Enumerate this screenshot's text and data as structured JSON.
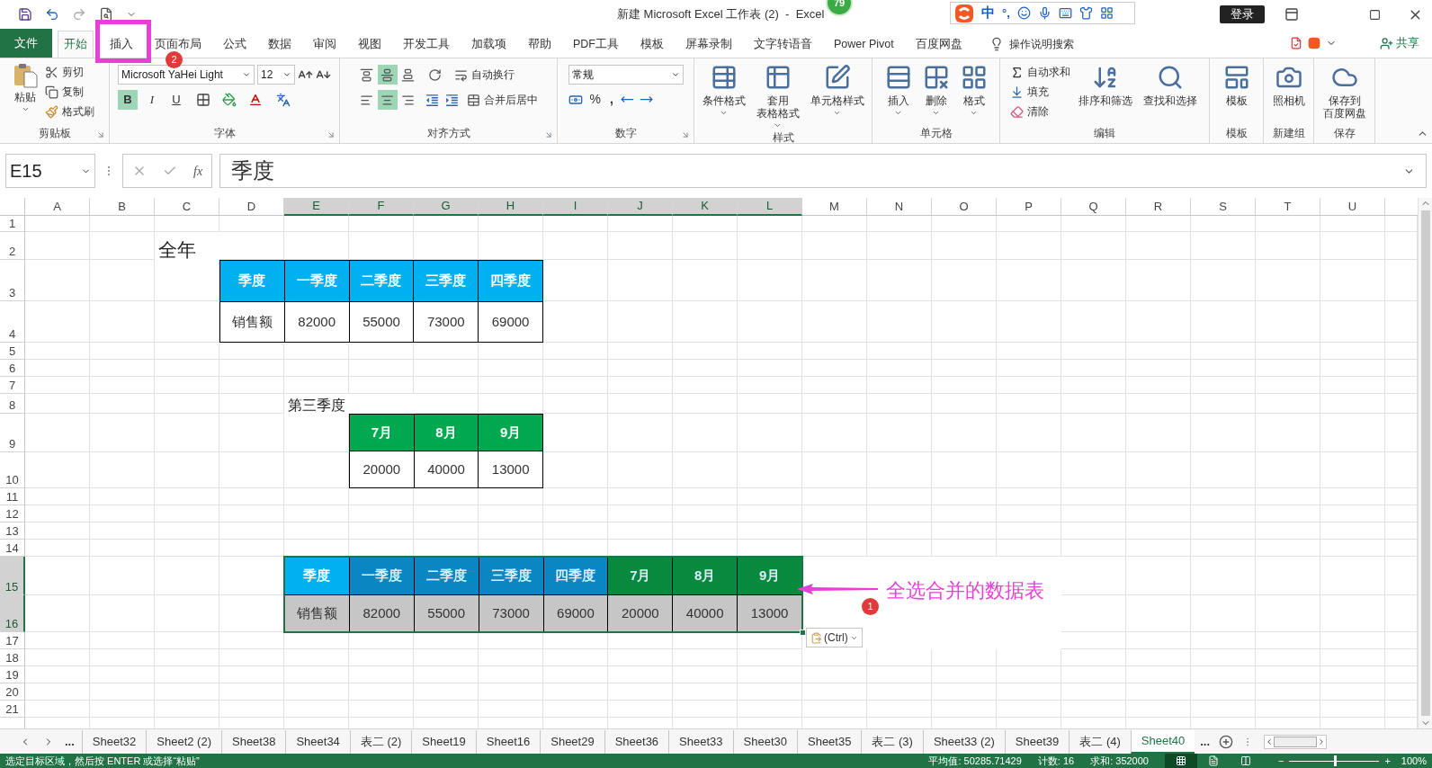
{
  "window": {
    "title": "新建 Microsoft Excel 工作表 (2)  -  Excel",
    "login": "登录",
    "floating_badge": "79",
    "ime": {
      "mode": "中",
      "punct": "°,"
    }
  },
  "menu_tabs": [
    {
      "label": "文件",
      "kind": "file",
      "selected": false
    },
    {
      "label": "开始",
      "kind": "tab",
      "selected": true
    },
    {
      "label": "插入",
      "kind": "tab",
      "selected": false
    },
    {
      "label": "页面布局",
      "kind": "tab",
      "selected": false
    },
    {
      "label": "公式",
      "kind": "tab",
      "selected": false
    },
    {
      "label": "数据",
      "kind": "tab",
      "selected": false
    },
    {
      "label": "审阅",
      "kind": "tab",
      "selected": false
    },
    {
      "label": "视图",
      "kind": "tab",
      "selected": false
    },
    {
      "label": "开发工具",
      "kind": "tab",
      "selected": false
    },
    {
      "label": "加载项",
      "kind": "tab",
      "selected": false
    },
    {
      "label": "帮助",
      "kind": "tab",
      "selected": false
    },
    {
      "label": "PDF工具",
      "kind": "tab",
      "selected": false
    },
    {
      "label": "模板",
      "kind": "tab",
      "selected": false
    },
    {
      "label": "屏幕录制",
      "kind": "tab",
      "selected": false
    },
    {
      "label": "文字转语音",
      "kind": "tab",
      "selected": false
    },
    {
      "label": "Power Pivot",
      "kind": "tab",
      "selected": false
    },
    {
      "label": "百度网盘",
      "kind": "tab",
      "selected": false
    },
    {
      "label": "操作说明搜索",
      "kind": "search",
      "selected": false
    }
  ],
  "share": "共享",
  "ribbon": {
    "clipboard": {
      "label": "剪贴板",
      "paste": "粘贴",
      "cut": "剪切",
      "copy": "复制",
      "format_painter": "格式刷"
    },
    "font": {
      "label": "字体",
      "name": "Microsoft YaHei Light",
      "size": "12",
      "toggles": [
        {
          "text": "B",
          "selected": true
        },
        {
          "text": "I",
          "selected": false
        },
        {
          "text": "U",
          "selected": false
        }
      ]
    },
    "alignment": {
      "label": "对齐方式",
      "vertical": [
        {
          "selected": false
        },
        {
          "selected": true
        },
        {
          "selected": false
        }
      ],
      "horizontal": [
        {
          "selected": false
        },
        {
          "selected": true
        },
        {
          "selected": false
        }
      ],
      "wrap": "自动换行",
      "merge": "合并后居中"
    },
    "number": {
      "label": "数字",
      "format": "常规",
      "percent": "%",
      "comma": ","
    },
    "styles": {
      "label": "样式",
      "items": [
        {
          "lines": [
            "条件格式"
          ]
        },
        {
          "lines": [
            "套用",
            "表格格式"
          ]
        },
        {
          "lines": [
            "单元格样式"
          ]
        }
      ]
    },
    "cells": {
      "label": "单元格",
      "items": [
        {
          "lines": [
            "插入"
          ]
        },
        {
          "lines": [
            "删除"
          ]
        },
        {
          "lines": [
            "格式"
          ]
        }
      ]
    },
    "editing": {
      "label": "编辑",
      "small": [
        "自动求和",
        "填充",
        "清除"
      ],
      "large": [
        {
          "lines": [
            "排序和筛选"
          ]
        },
        {
          "lines": [
            "查找和选择"
          ]
        }
      ]
    },
    "extra_groups": [
      {
        "label": "模板",
        "items": [
          {
            "lines": [
              "模板"
            ]
          }
        ]
      },
      {
        "label": "新建组",
        "items": [
          {
            "lines": [
              "照相机"
            ]
          }
        ]
      },
      {
        "label": "保存",
        "items": [
          {
            "lines": [
              "保存到",
              "百度网盘"
            ]
          }
        ]
      }
    ]
  },
  "formula_bar": {
    "name_box": "E15",
    "fx": "fx",
    "value": "季度"
  },
  "sheet": {
    "columns": [
      {
        "label": "A",
        "selected": false
      },
      {
        "label": "B",
        "selected": false
      },
      {
        "label": "C",
        "selected": false
      },
      {
        "label": "D",
        "selected": false
      },
      {
        "label": "E",
        "selected": true
      },
      {
        "label": "F",
        "selected": true
      },
      {
        "label": "G",
        "selected": true
      },
      {
        "label": "H",
        "selected": true
      },
      {
        "label": "I",
        "selected": true
      },
      {
        "label": "J",
        "selected": true
      },
      {
        "label": "K",
        "selected": true
      },
      {
        "label": "L",
        "selected": true
      },
      {
        "label": "M",
        "selected": false
      },
      {
        "label": "N",
        "selected": false
      },
      {
        "label": "O",
        "selected": false
      },
      {
        "label": "P",
        "selected": false
      },
      {
        "label": "Q",
        "selected": false
      },
      {
        "label": "R",
        "selected": false
      },
      {
        "label": "S",
        "selected": false
      },
      {
        "label": "T",
        "selected": false
      },
      {
        "label": "U",
        "selected": false
      }
    ],
    "rows": [
      {
        "label": "1",
        "selected": false
      },
      {
        "label": "2",
        "selected": false
      },
      {
        "label": "3",
        "selected": false
      },
      {
        "label": "4",
        "selected": false
      },
      {
        "label": "5",
        "selected": false
      },
      {
        "label": "6",
        "selected": false
      },
      {
        "label": "7",
        "selected": false
      },
      {
        "label": "8",
        "selected": false
      },
      {
        "label": "9",
        "selected": false
      },
      {
        "label": "10",
        "selected": false
      },
      {
        "label": "11",
        "selected": false
      },
      {
        "label": "12",
        "selected": false
      },
      {
        "label": "13",
        "selected": false
      },
      {
        "label": "14",
        "selected": false
      },
      {
        "label": "15",
        "selected": true
      },
      {
        "label": "16",
        "selected": true
      },
      {
        "label": "17",
        "selected": false
      },
      {
        "label": "18",
        "selected": false
      },
      {
        "label": "19",
        "selected": false
      },
      {
        "label": "20",
        "selected": false
      },
      {
        "label": "21",
        "selected": false
      }
    ],
    "titles": [
      {
        "text": "全年"
      },
      {
        "text": "第三季度"
      }
    ],
    "tables": [
      {
        "selected": false,
        "header": [
          {
            "text": "季度",
            "color": "#00b0f0"
          },
          {
            "text": "一季度",
            "color": "#00b0f0"
          },
          {
            "text": "二季度",
            "color": "#00b0f0"
          },
          {
            "text": "三季度",
            "color": "#00b0f0"
          },
          {
            "text": "四季度",
            "color": "#00b0f0"
          }
        ],
        "values": [
          "销售额",
          "82000",
          "55000",
          "73000",
          "69000"
        ]
      },
      {
        "selected": false,
        "header": [
          {
            "text": "7月",
            "color": "#00a84f"
          },
          {
            "text": "8月",
            "color": "#00a84f"
          },
          {
            "text": "9月",
            "color": "#00a84f"
          }
        ],
        "values": [
          "20000",
          "40000",
          "13000"
        ]
      },
      {
        "selected": true,
        "header": [
          {
            "text": "季度",
            "color": "#00b0f0"
          },
          {
            "text": "一季度",
            "color": "#0a86c2"
          },
          {
            "text": "二季度",
            "color": "#0a86c2"
          },
          {
            "text": "三季度",
            "color": "#0a86c2"
          },
          {
            "text": "四季度",
            "color": "#0a86c2"
          },
          {
            "text": "7月",
            "color": "#088a3e"
          },
          {
            "text": "8月",
            "color": "#088a3e"
          },
          {
            "text": "9月",
            "color": "#088a3e"
          }
        ],
        "values": [
          "销售额",
          "82000",
          "55000",
          "73000",
          "69000",
          "20000",
          "40000",
          "13000"
        ]
      }
    ],
    "paste_options": "(Ctrl)"
  },
  "annotations": {
    "tab_marker": "2",
    "arrow_marker": "1",
    "note": "全选合并的数据表"
  },
  "sheet_tabs": [
    {
      "label": "Sheet32",
      "selected": false
    },
    {
      "label": "Sheet2 (2)",
      "selected": false
    },
    {
      "label": "Sheet38",
      "selected": false
    },
    {
      "label": "Sheet34",
      "selected": false
    },
    {
      "label": "表二 (2)",
      "selected": false
    },
    {
      "label": "Sheet19",
      "selected": false
    },
    {
      "label": "Sheet16",
      "selected": false
    },
    {
      "label": "Sheet29",
      "selected": false
    },
    {
      "label": "Sheet36",
      "selected": false
    },
    {
      "label": "Sheet33",
      "selected": false
    },
    {
      "label": "Sheet30",
      "selected": false
    },
    {
      "label": "Sheet35",
      "selected": false
    },
    {
      "label": "表二 (3)",
      "selected": false
    },
    {
      "label": "Sheet33 (2)",
      "selected": false
    },
    {
      "label": "Sheet39",
      "selected": false
    },
    {
      "label": "表二 (4)",
      "selected": false
    },
    {
      "label": "Sheet40",
      "selected": true
    }
  ],
  "sheet_tabs_more": "...",
  "status_bar": {
    "message": "选定目标区域，然后按 ENTER 或选择“粘贴”",
    "stats": [
      "平均值: 50285.71429",
      "计数: 16",
      "求和: 352000"
    ],
    "views": [
      {
        "selected": true
      },
      {
        "selected": false
      },
      {
        "selected": false
      }
    ],
    "zoom_minus": "−",
    "zoom_plus": "+",
    "zoom": {
      "level": 0.5
    },
    "zoom_percent": "100%"
  }
}
